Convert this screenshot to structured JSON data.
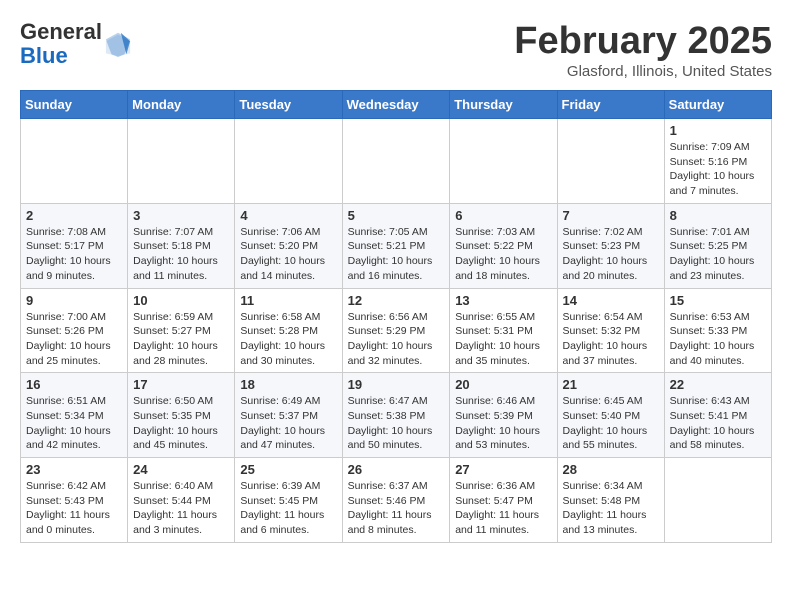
{
  "header": {
    "logo_general": "General",
    "logo_blue": "Blue",
    "month_title": "February 2025",
    "location": "Glasford, Illinois, United States"
  },
  "weekdays": [
    "Sunday",
    "Monday",
    "Tuesday",
    "Wednesday",
    "Thursday",
    "Friday",
    "Saturday"
  ],
  "weeks": [
    [
      {
        "day": "",
        "content": ""
      },
      {
        "day": "",
        "content": ""
      },
      {
        "day": "",
        "content": ""
      },
      {
        "day": "",
        "content": ""
      },
      {
        "day": "",
        "content": ""
      },
      {
        "day": "",
        "content": ""
      },
      {
        "day": "1",
        "content": "Sunrise: 7:09 AM\nSunset: 5:16 PM\nDaylight: 10 hours and 7 minutes."
      }
    ],
    [
      {
        "day": "2",
        "content": "Sunrise: 7:08 AM\nSunset: 5:17 PM\nDaylight: 10 hours and 9 minutes."
      },
      {
        "day": "3",
        "content": "Sunrise: 7:07 AM\nSunset: 5:18 PM\nDaylight: 10 hours and 11 minutes."
      },
      {
        "day": "4",
        "content": "Sunrise: 7:06 AM\nSunset: 5:20 PM\nDaylight: 10 hours and 14 minutes."
      },
      {
        "day": "5",
        "content": "Sunrise: 7:05 AM\nSunset: 5:21 PM\nDaylight: 10 hours and 16 minutes."
      },
      {
        "day": "6",
        "content": "Sunrise: 7:03 AM\nSunset: 5:22 PM\nDaylight: 10 hours and 18 minutes."
      },
      {
        "day": "7",
        "content": "Sunrise: 7:02 AM\nSunset: 5:23 PM\nDaylight: 10 hours and 20 minutes."
      },
      {
        "day": "8",
        "content": "Sunrise: 7:01 AM\nSunset: 5:25 PM\nDaylight: 10 hours and 23 minutes."
      }
    ],
    [
      {
        "day": "9",
        "content": "Sunrise: 7:00 AM\nSunset: 5:26 PM\nDaylight: 10 hours and 25 minutes."
      },
      {
        "day": "10",
        "content": "Sunrise: 6:59 AM\nSunset: 5:27 PM\nDaylight: 10 hours and 28 minutes."
      },
      {
        "day": "11",
        "content": "Sunrise: 6:58 AM\nSunset: 5:28 PM\nDaylight: 10 hours and 30 minutes."
      },
      {
        "day": "12",
        "content": "Sunrise: 6:56 AM\nSunset: 5:29 PM\nDaylight: 10 hours and 32 minutes."
      },
      {
        "day": "13",
        "content": "Sunrise: 6:55 AM\nSunset: 5:31 PM\nDaylight: 10 hours and 35 minutes."
      },
      {
        "day": "14",
        "content": "Sunrise: 6:54 AM\nSunset: 5:32 PM\nDaylight: 10 hours and 37 minutes."
      },
      {
        "day": "15",
        "content": "Sunrise: 6:53 AM\nSunset: 5:33 PM\nDaylight: 10 hours and 40 minutes."
      }
    ],
    [
      {
        "day": "16",
        "content": "Sunrise: 6:51 AM\nSunset: 5:34 PM\nDaylight: 10 hours and 42 minutes."
      },
      {
        "day": "17",
        "content": "Sunrise: 6:50 AM\nSunset: 5:35 PM\nDaylight: 10 hours and 45 minutes."
      },
      {
        "day": "18",
        "content": "Sunrise: 6:49 AM\nSunset: 5:37 PM\nDaylight: 10 hours and 47 minutes."
      },
      {
        "day": "19",
        "content": "Sunrise: 6:47 AM\nSunset: 5:38 PM\nDaylight: 10 hours and 50 minutes."
      },
      {
        "day": "20",
        "content": "Sunrise: 6:46 AM\nSunset: 5:39 PM\nDaylight: 10 hours and 53 minutes."
      },
      {
        "day": "21",
        "content": "Sunrise: 6:45 AM\nSunset: 5:40 PM\nDaylight: 10 hours and 55 minutes."
      },
      {
        "day": "22",
        "content": "Sunrise: 6:43 AM\nSunset: 5:41 PM\nDaylight: 10 hours and 58 minutes."
      }
    ],
    [
      {
        "day": "23",
        "content": "Sunrise: 6:42 AM\nSunset: 5:43 PM\nDaylight: 11 hours and 0 minutes."
      },
      {
        "day": "24",
        "content": "Sunrise: 6:40 AM\nSunset: 5:44 PM\nDaylight: 11 hours and 3 minutes."
      },
      {
        "day": "25",
        "content": "Sunrise: 6:39 AM\nSunset: 5:45 PM\nDaylight: 11 hours and 6 minutes."
      },
      {
        "day": "26",
        "content": "Sunrise: 6:37 AM\nSunset: 5:46 PM\nDaylight: 11 hours and 8 minutes."
      },
      {
        "day": "27",
        "content": "Sunrise: 6:36 AM\nSunset: 5:47 PM\nDaylight: 11 hours and 11 minutes."
      },
      {
        "day": "28",
        "content": "Sunrise: 6:34 AM\nSunset: 5:48 PM\nDaylight: 11 hours and 13 minutes."
      },
      {
        "day": "",
        "content": ""
      }
    ]
  ]
}
